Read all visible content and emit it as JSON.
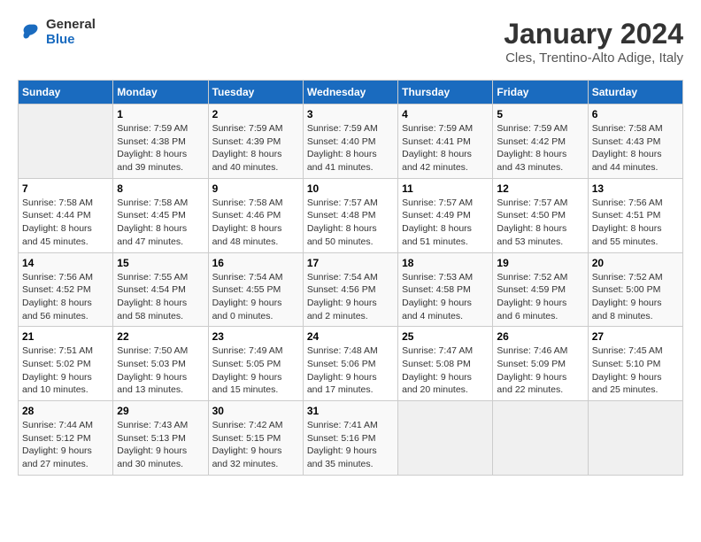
{
  "header": {
    "logo_line1": "General",
    "logo_line2": "Blue",
    "month": "January 2024",
    "location": "Cles, Trentino-Alto Adige, Italy"
  },
  "weekdays": [
    "Sunday",
    "Monday",
    "Tuesday",
    "Wednesday",
    "Thursday",
    "Friday",
    "Saturday"
  ],
  "weeks": [
    [
      {
        "day": "",
        "info": ""
      },
      {
        "day": "1",
        "info": "Sunrise: 7:59 AM\nSunset: 4:38 PM\nDaylight: 8 hours\nand 39 minutes."
      },
      {
        "day": "2",
        "info": "Sunrise: 7:59 AM\nSunset: 4:39 PM\nDaylight: 8 hours\nand 40 minutes."
      },
      {
        "day": "3",
        "info": "Sunrise: 7:59 AM\nSunset: 4:40 PM\nDaylight: 8 hours\nand 41 minutes."
      },
      {
        "day": "4",
        "info": "Sunrise: 7:59 AM\nSunset: 4:41 PM\nDaylight: 8 hours\nand 42 minutes."
      },
      {
        "day": "5",
        "info": "Sunrise: 7:59 AM\nSunset: 4:42 PM\nDaylight: 8 hours\nand 43 minutes."
      },
      {
        "day": "6",
        "info": "Sunrise: 7:58 AM\nSunset: 4:43 PM\nDaylight: 8 hours\nand 44 minutes."
      }
    ],
    [
      {
        "day": "7",
        "info": "Sunrise: 7:58 AM\nSunset: 4:44 PM\nDaylight: 8 hours\nand 45 minutes."
      },
      {
        "day": "8",
        "info": "Sunrise: 7:58 AM\nSunset: 4:45 PM\nDaylight: 8 hours\nand 47 minutes."
      },
      {
        "day": "9",
        "info": "Sunrise: 7:58 AM\nSunset: 4:46 PM\nDaylight: 8 hours\nand 48 minutes."
      },
      {
        "day": "10",
        "info": "Sunrise: 7:57 AM\nSunset: 4:48 PM\nDaylight: 8 hours\nand 50 minutes."
      },
      {
        "day": "11",
        "info": "Sunrise: 7:57 AM\nSunset: 4:49 PM\nDaylight: 8 hours\nand 51 minutes."
      },
      {
        "day": "12",
        "info": "Sunrise: 7:57 AM\nSunset: 4:50 PM\nDaylight: 8 hours\nand 53 minutes."
      },
      {
        "day": "13",
        "info": "Sunrise: 7:56 AM\nSunset: 4:51 PM\nDaylight: 8 hours\nand 55 minutes."
      }
    ],
    [
      {
        "day": "14",
        "info": "Sunrise: 7:56 AM\nSunset: 4:52 PM\nDaylight: 8 hours\nand 56 minutes."
      },
      {
        "day": "15",
        "info": "Sunrise: 7:55 AM\nSunset: 4:54 PM\nDaylight: 8 hours\nand 58 minutes."
      },
      {
        "day": "16",
        "info": "Sunrise: 7:54 AM\nSunset: 4:55 PM\nDaylight: 9 hours\nand 0 minutes."
      },
      {
        "day": "17",
        "info": "Sunrise: 7:54 AM\nSunset: 4:56 PM\nDaylight: 9 hours\nand 2 minutes."
      },
      {
        "day": "18",
        "info": "Sunrise: 7:53 AM\nSunset: 4:58 PM\nDaylight: 9 hours\nand 4 minutes."
      },
      {
        "day": "19",
        "info": "Sunrise: 7:52 AM\nSunset: 4:59 PM\nDaylight: 9 hours\nand 6 minutes."
      },
      {
        "day": "20",
        "info": "Sunrise: 7:52 AM\nSunset: 5:00 PM\nDaylight: 9 hours\nand 8 minutes."
      }
    ],
    [
      {
        "day": "21",
        "info": "Sunrise: 7:51 AM\nSunset: 5:02 PM\nDaylight: 9 hours\nand 10 minutes."
      },
      {
        "day": "22",
        "info": "Sunrise: 7:50 AM\nSunset: 5:03 PM\nDaylight: 9 hours\nand 13 minutes."
      },
      {
        "day": "23",
        "info": "Sunrise: 7:49 AM\nSunset: 5:05 PM\nDaylight: 9 hours\nand 15 minutes."
      },
      {
        "day": "24",
        "info": "Sunrise: 7:48 AM\nSunset: 5:06 PM\nDaylight: 9 hours\nand 17 minutes."
      },
      {
        "day": "25",
        "info": "Sunrise: 7:47 AM\nSunset: 5:08 PM\nDaylight: 9 hours\nand 20 minutes."
      },
      {
        "day": "26",
        "info": "Sunrise: 7:46 AM\nSunset: 5:09 PM\nDaylight: 9 hours\nand 22 minutes."
      },
      {
        "day": "27",
        "info": "Sunrise: 7:45 AM\nSunset: 5:10 PM\nDaylight: 9 hours\nand 25 minutes."
      }
    ],
    [
      {
        "day": "28",
        "info": "Sunrise: 7:44 AM\nSunset: 5:12 PM\nDaylight: 9 hours\nand 27 minutes."
      },
      {
        "day": "29",
        "info": "Sunrise: 7:43 AM\nSunset: 5:13 PM\nDaylight: 9 hours\nand 30 minutes."
      },
      {
        "day": "30",
        "info": "Sunrise: 7:42 AM\nSunset: 5:15 PM\nDaylight: 9 hours\nand 32 minutes."
      },
      {
        "day": "31",
        "info": "Sunrise: 7:41 AM\nSunset: 5:16 PM\nDaylight: 9 hours\nand 35 minutes."
      },
      {
        "day": "",
        "info": ""
      },
      {
        "day": "",
        "info": ""
      },
      {
        "day": "",
        "info": ""
      }
    ]
  ]
}
